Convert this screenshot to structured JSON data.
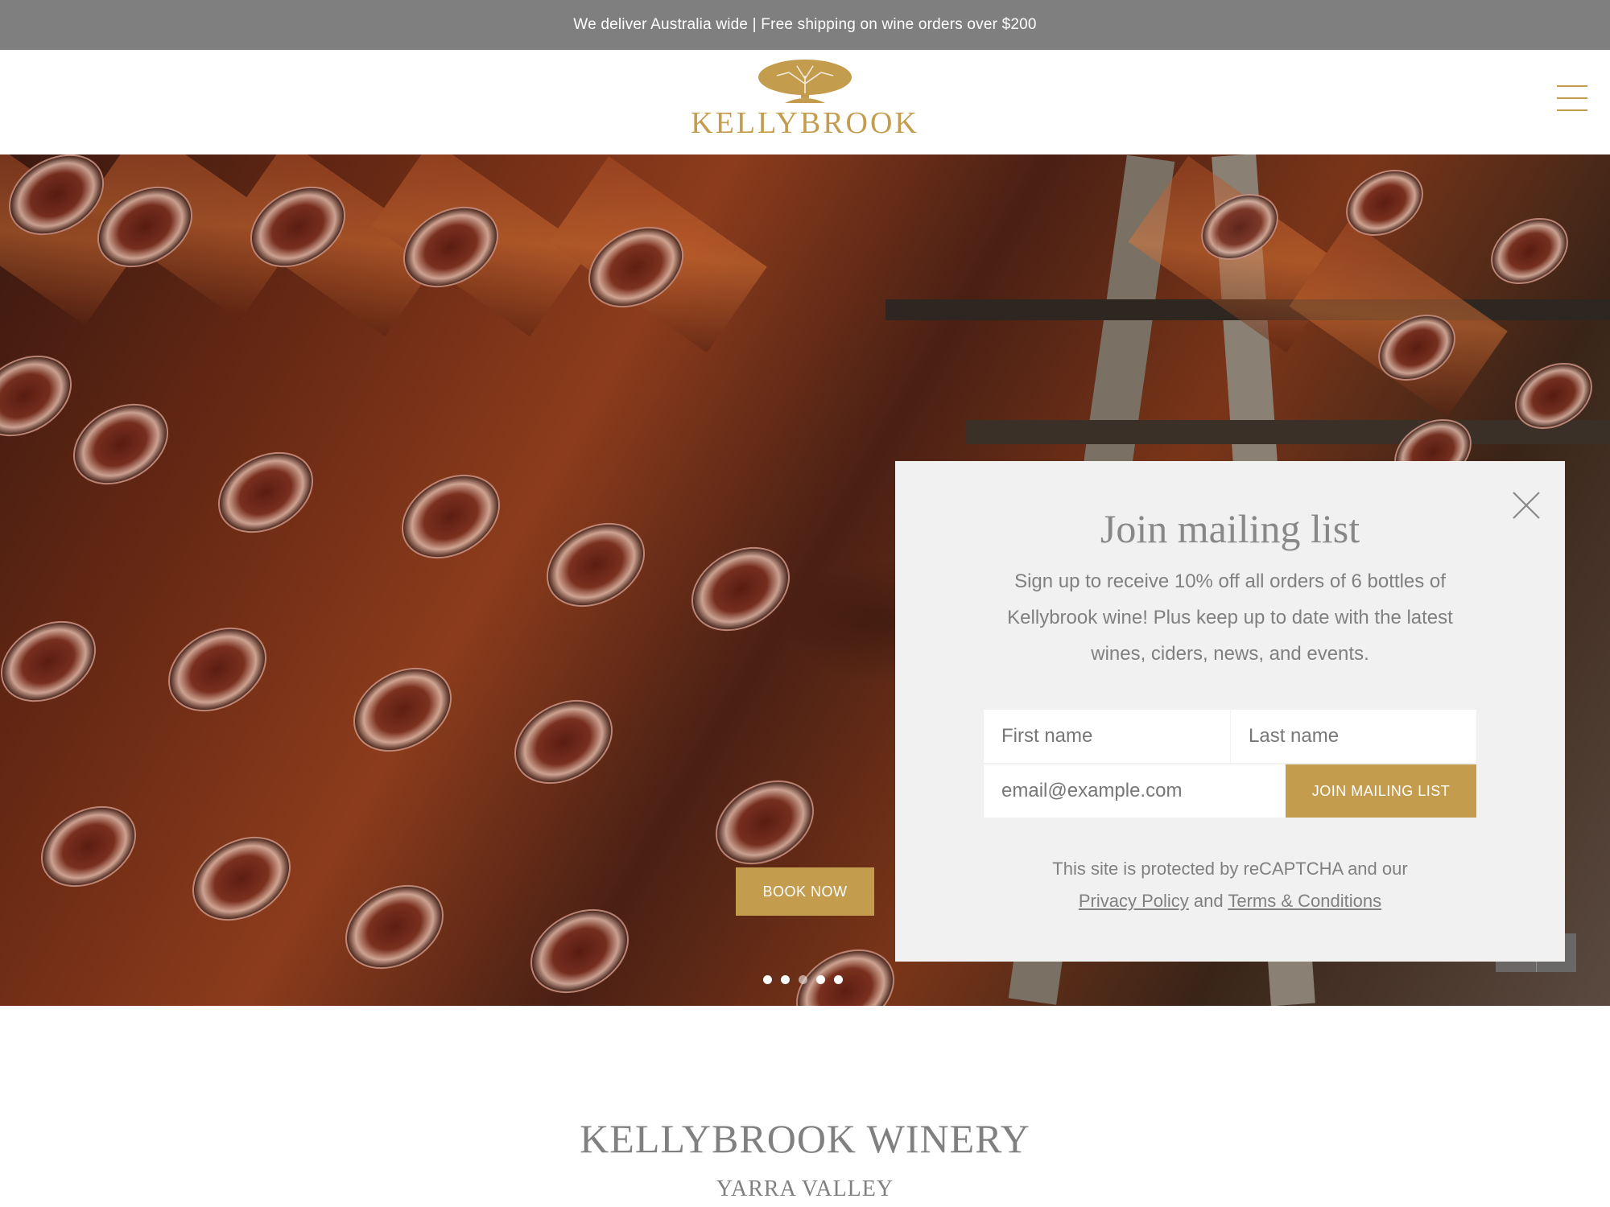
{
  "announcement": "We deliver Australia wide | Free shipping on wine orders over $200",
  "brand": {
    "name": "KELLYBROOK",
    "color": "#c39c4e"
  },
  "hero": {
    "book_now_label": "BOOK NOW",
    "slide_dots": 5
  },
  "popup": {
    "title": "Join mailing list",
    "text": "Sign up to receive 10% off all orders of 6 bottles of Kellybrook wine! Plus keep up to date with the latest wines, ciders, news, and events.",
    "first_name_placeholder": "First name",
    "last_name_placeholder": "Last name",
    "email_placeholder": "email@example.com",
    "join_label": "JOIN MAILING LIST",
    "recaptcha_text": "This site is protected by reCAPTCHA and our",
    "privacy_link": "Privacy Policy",
    "and_text": "and",
    "terms_link": "Terms & Conditions"
  },
  "section": {
    "title": "KELLYBROOK WINERY",
    "subtitle": "YARRA VALLEY"
  }
}
